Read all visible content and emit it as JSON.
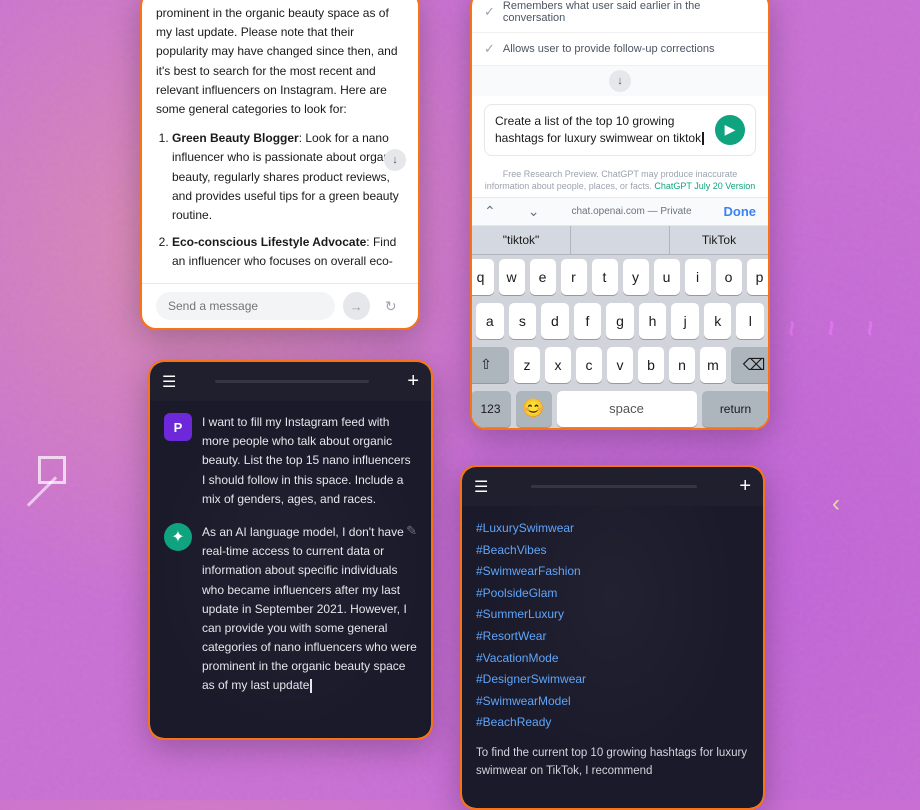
{
  "background": {
    "color": "#c96fd4"
  },
  "phone1": {
    "intro_text": "prominent in the organic beauty space as of my last update. Please note that their popularity may have changed since then, and it's best to search for the most recent and relevant influencers on Instagram. Here are some general categories to look for:",
    "items": [
      {
        "title": "Green Beauty Blogger",
        "desc": "Look for a nano influencer who is passionate about organic beauty, regularly shares product reviews, and provides useful tips for a green beauty routine."
      },
      {
        "title": "Eco-conscious Lifestyle Advocate",
        "desc": "Find an influencer who focuses on overall eco-"
      }
    ],
    "input_placeholder": "Send a message",
    "send_label": "→",
    "refresh_label": "↻"
  },
  "phone2": {
    "capabilities": [
      "Remembers what user said earlier in the conversation",
      "Allows user to provide follow-up corrections"
    ],
    "scroll_icon": "↓",
    "input_text": "Create a list of the top 10 growing hashtags for luxury swimwear on tiktok",
    "cursor": "|",
    "send_label": "▶",
    "disclaimer": "Free Research Preview. ChatGPT may produce inaccurate information about people, places, or facts.",
    "disclaimer_link": "ChatGPT July 20 Version",
    "url": "chat.openai.com",
    "url_label": "— Private",
    "done_label": "Done",
    "keyboard": {
      "suggestions": [
        "\"tiktok\"",
        "",
        "TikTok"
      ],
      "row1": [
        "q",
        "w",
        "e",
        "r",
        "t",
        "y",
        "u",
        "i",
        "o",
        "p"
      ],
      "row2": [
        "a",
        "s",
        "d",
        "f",
        "g",
        "h",
        "j",
        "k",
        "l"
      ],
      "row3": [
        "z",
        "x",
        "c",
        "v",
        "b",
        "n",
        "m"
      ],
      "bottom": [
        "123",
        "😊",
        "space",
        "return"
      ]
    }
  },
  "phone3": {
    "titlebar": {
      "menu_icon": "☰",
      "plus_icon": "+"
    },
    "user_message": "I want to fill my Instagram feed with more people who talk about organic beauty. List the top 15 nano influencers I should follow in this space. Include a mix of genders, ages, and races.",
    "user_avatar": "P",
    "edit_icon": "✎",
    "ai_avatar": "✦",
    "ai_message": "As an AI language model, I don't have real-time access to current data or information about specific individuals who became influencers after my last update in September 2021. However, I can provide you with some general categories of nano influencers who were prominent in the organic beauty space as of my last update"
  },
  "phone4": {
    "titlebar": {
      "menu_icon": "☰",
      "plus_icon": "+"
    },
    "hashtags": [
      "#LuxurySwimwear",
      "#BeachVibes",
      "#SwimwearFashion",
      "#PoolsideGlam",
      "#SummerLuxury",
      "#ResortWear",
      "#VacationMode",
      "#DesignerSwimwear",
      "#SwimwearModel",
      "#BeachReady"
    ],
    "summary_text": "To find the current top 10 growing hashtags for luxury swimwear on TikTok, I recommend"
  }
}
